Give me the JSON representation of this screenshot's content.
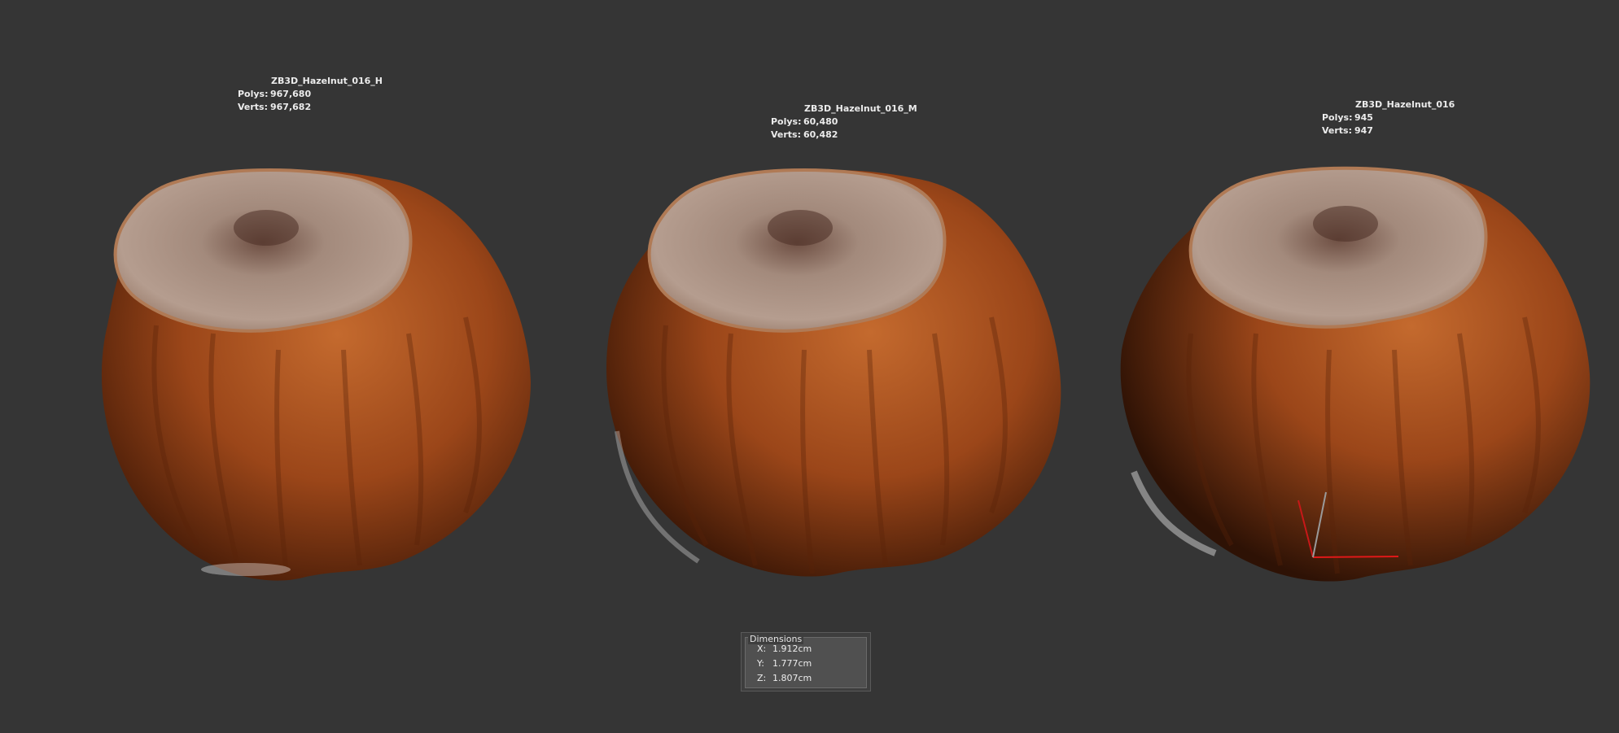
{
  "viewport": {
    "background": "#353535"
  },
  "objects": [
    {
      "name": "ZB3D_Hazelnut_016_H",
      "polys_label": "Polys:",
      "polys": "967,680",
      "verts_label": "Verts:",
      "verts": "967,682"
    },
    {
      "name": "ZB3D_Hazelnut_016_M",
      "polys_label": "Polys:",
      "polys": "60,480",
      "verts_label": "Verts:",
      "verts": "60,482"
    },
    {
      "name": "ZB3D_Hazelnut_016",
      "polys_label": "Polys:",
      "polys": "945",
      "verts_label": "Verts:",
      "verts": "947"
    }
  ],
  "dimensions": {
    "title": "Dimensions",
    "x_label": "X:",
    "x": "1.912cm",
    "y_label": "Y:",
    "y": "1.777cm",
    "z_label": "Z:",
    "z": "1.807cm"
  },
  "colors": {
    "shell_dark": "#4a1d08",
    "shell_mid": "#9b4619",
    "shell_light": "#c46a2e",
    "cap": "#8f7466",
    "cap_light": "#b59d8f",
    "gizmo_x": "#e01818",
    "gizmo_y": "#c81818",
    "gizmo_z": "#9a9a9a"
  }
}
